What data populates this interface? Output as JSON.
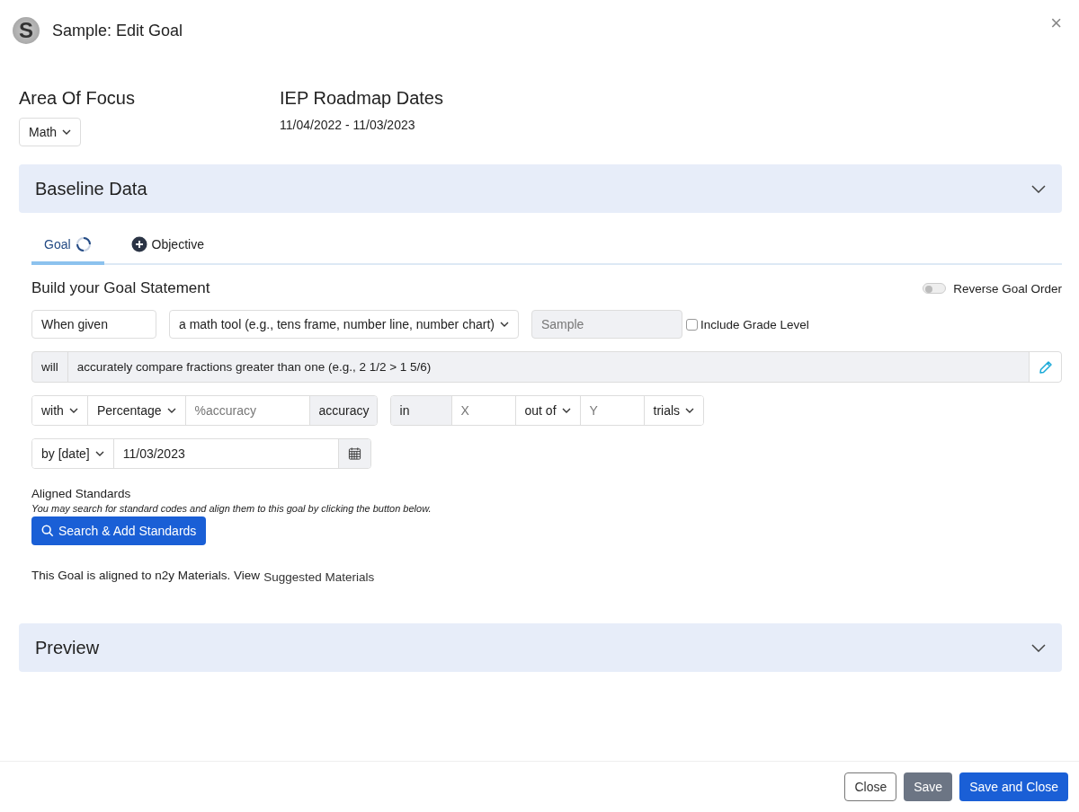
{
  "header": {
    "avatar_letter": "S",
    "title": "Sample: Edit Goal",
    "close": "×"
  },
  "area_of_focus": {
    "label": "Area Of Focus",
    "value": "Math"
  },
  "roadmap": {
    "label": "IEP Roadmap Dates",
    "dates": "11/04/2022 - 11/03/2023"
  },
  "baseline": {
    "title": "Baseline Data",
    "expanded": false
  },
  "tabs": [
    {
      "label": "Goal",
      "kind": "loading",
      "selected": true
    },
    {
      "label": "Objective",
      "kind": "add",
      "selected": false
    }
  ],
  "builder": {
    "heading": "Build your Goal Statement",
    "reverse_toggle": {
      "label": "Reverse Goal Order",
      "on": false
    }
  },
  "row_given": {
    "given": "When given",
    "tool": "a math tool (e.g., tens frame, number line, number chart)",
    "grade_placeholder": "Sample",
    "include_grade": {
      "label": "Include Grade Level",
      "checked": false
    }
  },
  "will_row": {
    "prefix": "will",
    "text": "accurately compare fractions greater than one (e.g., 2 1/2 > 1 5/6)"
  },
  "measure_groups": [
    [
      {
        "kind": "dropdown",
        "text": "with"
      },
      {
        "kind": "dropdown",
        "text": "Percentage"
      },
      {
        "kind": "input",
        "placeholder": "%accuracy"
      },
      {
        "kind": "addon",
        "text": "accuracy"
      }
    ],
    [
      {
        "kind": "addon",
        "text": "in"
      },
      {
        "kind": "input",
        "placeholder": "X"
      },
      {
        "kind": "dropdown",
        "text": "out of"
      },
      {
        "kind": "input",
        "placeholder": "Y"
      },
      {
        "kind": "dropdown",
        "text": "trials"
      }
    ],
    [
      {
        "kind": "dropdown",
        "text": "by [date]"
      },
      {
        "kind": "input",
        "value": "11/03/2023"
      },
      {
        "kind": "calendar"
      }
    ]
  ],
  "standards": {
    "label": "Aligned Standards",
    "hint": "You may search for standard codes and align them to this goal by clicking the button below.",
    "button": "Search & Add Standards"
  },
  "alignment": {
    "text": "This Goal is aligned to n2y Materials. View",
    "link": "Suggested Materials"
  },
  "preview": {
    "title": "Preview",
    "expanded": false
  },
  "footer_buttons": [
    {
      "label": "Close",
      "kind": "outline"
    },
    {
      "label": "Save",
      "kind": "secondary"
    },
    {
      "label": "Save and Close",
      "kind": "primary"
    }
  ]
}
